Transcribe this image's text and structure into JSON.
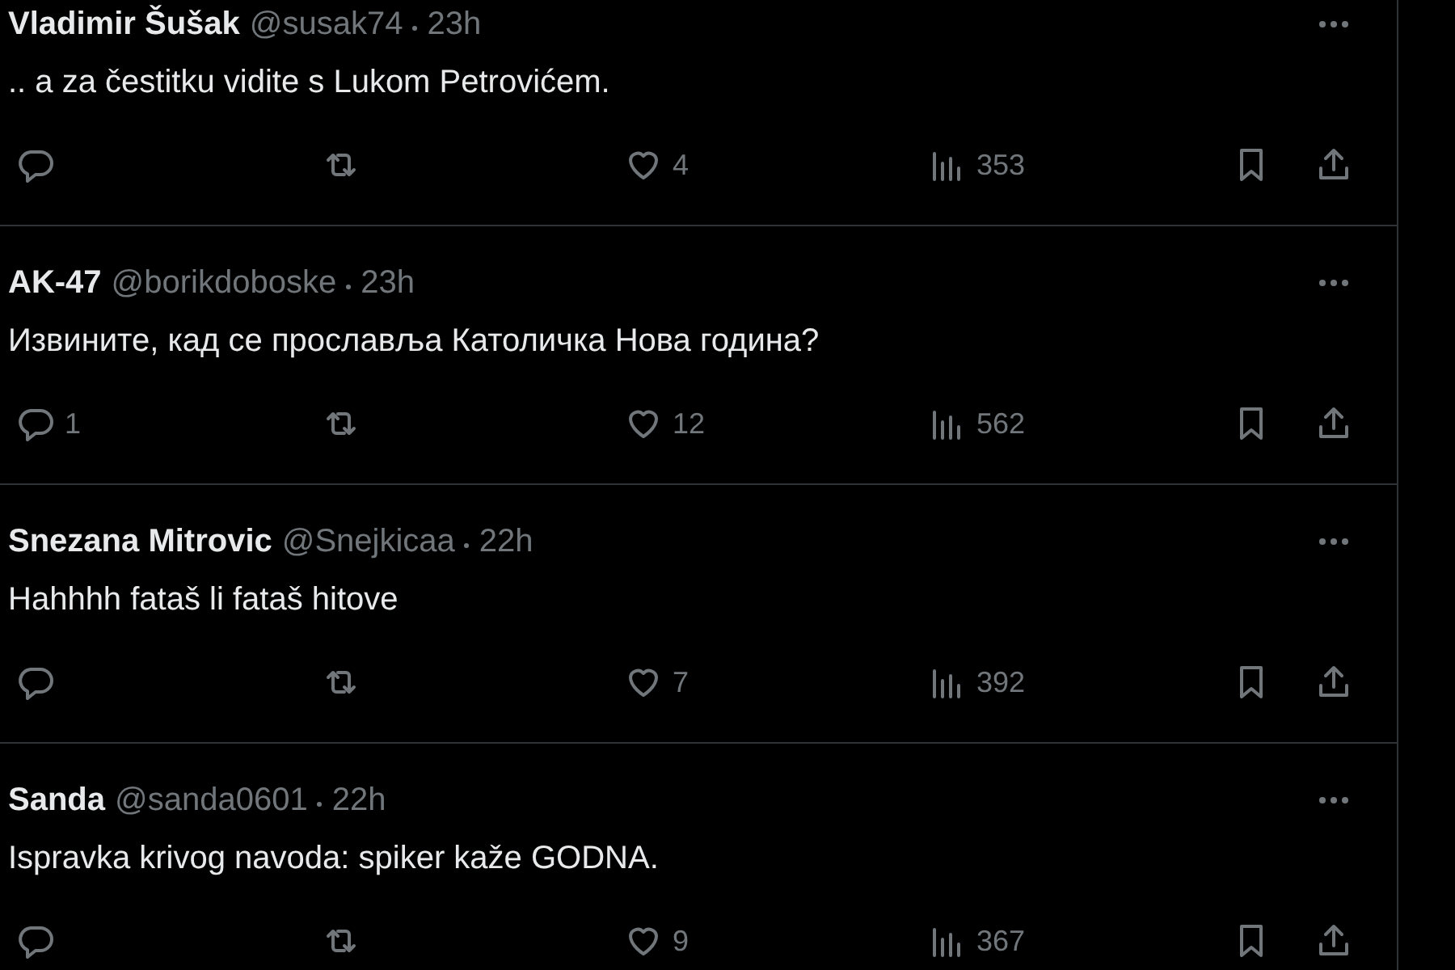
{
  "tweets": [
    {
      "name": "Vladimir Šušak",
      "handle": "@susak74",
      "time": "23h",
      "text": ".. a za čestitku vidite s Lukom Petrovićem.",
      "likes": "4",
      "views": "353"
    },
    {
      "name": "AK-47",
      "handle": "@borikdoboske",
      "time": "23h",
      "text": "Извините, кад се прославља Католичка Нова година?",
      "replies": "1",
      "likes": "12",
      "views": "562"
    },
    {
      "name": "Snezana Mitrovic",
      "handle": "@Snejkicaa",
      "time": "22h",
      "text": "Hahhhh fataš li fataš hitove",
      "likes": "7",
      "views": "392"
    },
    {
      "name": "Sanda",
      "handle": "@sanda0601",
      "time": "22h",
      "text": "Ispravka krivog navoda: spiker kaže GODNA.",
      "likes": "9",
      "views": "367"
    }
  ]
}
